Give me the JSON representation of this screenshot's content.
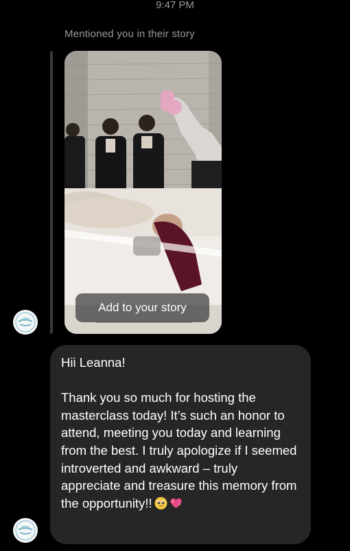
{
  "status_bar": {
    "time": "9:47 PM"
  },
  "story_mention": {
    "label": "Mentioned you in their story",
    "add_button_label": "Add to your story"
  },
  "message": {
    "greeting": "Hii Leanna!",
    "body": "Thank you so much for hosting the masterclass today! It’s such an honor to attend, meeting you today and learning from the best. I truly apologize if I seemed introverted and awkward – truly appreciate and treasure this memory from the opportunity!!",
    "emojis": [
      "pleading-face-icon",
      "sparkling-heart-icon"
    ]
  },
  "colors": {
    "background": "#000000",
    "bubble": "#262626",
    "secondary_text": "#9b9b9b",
    "reply_bar": "#3a3a3a"
  }
}
